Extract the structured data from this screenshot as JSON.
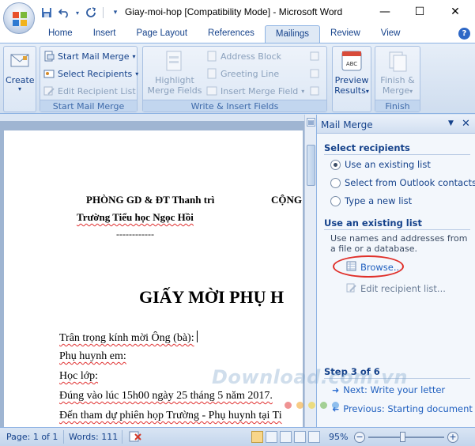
{
  "window": {
    "title": "Giay-moi-hop [Compatibility Mode] - Microsoft Word",
    "minimize": "—",
    "maximize": "☐",
    "close": "✕"
  },
  "qat": {
    "save_icon": "save-icon",
    "undo_icon": "undo-icon",
    "redo_icon": "redo-icon",
    "customize_icon": "customize-qat-icon"
  },
  "tabs": [
    {
      "label": "Home"
    },
    {
      "label": "Insert"
    },
    {
      "label": "Page Layout"
    },
    {
      "label": "References"
    },
    {
      "label": "Mailings",
      "active": true
    },
    {
      "label": "Review"
    },
    {
      "label": "View"
    }
  ],
  "help_label": "?",
  "ribbon": {
    "create": {
      "label": "Create",
      "arrow": "▾"
    },
    "start_group": {
      "start_mail_merge": "Start Mail Merge",
      "select_recipients": "Select Recipients",
      "edit_recipient_list": "Edit Recipient List",
      "group_label": "Start Mail Merge"
    },
    "write_group": {
      "highlight_merge_fields_1": "Highlight",
      "highlight_merge_fields_2": "Merge Fields",
      "address_block": "Address Block",
      "greeting_line": "Greeting Line",
      "insert_merge_field": "Insert Merge Field",
      "group_label": "Write & Insert Fields"
    },
    "preview": {
      "label_1": "Preview",
      "label_2": "Results",
      "arrow": "▾",
      "icon_text": "ABC"
    },
    "finish": {
      "label_1": "Finish &",
      "label_2": "Merge",
      "arrow": "▾",
      "group_label": "Finish"
    }
  },
  "document": {
    "line1_left": "PHÒNG GD & ĐT Thanh trì",
    "line1_right": "CỘNG",
    "line2": "Trường Tiểu học Ngọc Hồi",
    "line3": "------------",
    "heading": "GIẤY MỜI PHỤ H",
    "para1": "Trân trọng kính mời Ông (bà):",
    "para2": "Phụ huynh em:",
    "para3": "Học lớp:",
    "para4": "Đúng vào lúc 15h00 ngày 25 tháng 5 năm 2017.",
    "para5": "Đến tham dự phiên họp Trường - Phụ huynh tại Ti"
  },
  "task_pane": {
    "title": "Mail Merge",
    "dropdown_icon": "▼",
    "close_icon": "✕",
    "select_recipients_title": "Select recipients",
    "options": [
      {
        "label": "Use an existing list",
        "selected": true
      },
      {
        "label": "Select from Outlook contacts",
        "selected": false
      },
      {
        "label": "Type a new list",
        "selected": false
      }
    ],
    "existing_list_title": "Use an existing list",
    "existing_list_desc": "Use names and addresses from a file or a database.",
    "browse": "Browse...",
    "edit_recipient_list": "Edit recipient list...",
    "step": "Step 3 of 6",
    "next": "Next: Write your letter",
    "previous": "Previous: Starting document",
    "watermark": "Download.com.vn"
  },
  "status": {
    "page": "Page: 1 of 1",
    "words": "Words: 111",
    "zoom": "95%",
    "zoom_out": "−",
    "zoom_in": "+"
  },
  "colors": {
    "accent": "#15428b",
    "link": "#1f5fbf",
    "highlight_ellipse": "#e0302a"
  }
}
